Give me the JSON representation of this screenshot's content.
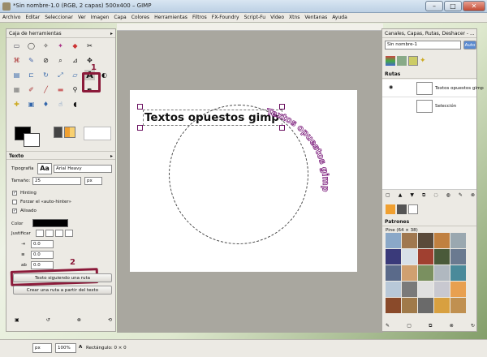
{
  "window": {
    "title": "*Sin nombre-1.0 (RGB, 2 capas) 500x400 – GIMP",
    "minimize": "–",
    "maximize": "□",
    "close": "✕"
  },
  "menu": [
    "Archivo",
    "Editar",
    "Seleccionar",
    "Ver",
    "Imagen",
    "Capa",
    "Colores",
    "Herramientas",
    "Filtros",
    "FX-Foundry",
    "Script-Fu",
    "Vídeo",
    "Xtns",
    "Ventanas",
    "Ayuda"
  ],
  "canvas": {
    "main_text": "Textos opuestos gimp",
    "path_text": "Textos opuestos gimp"
  },
  "toolbox": {
    "title": "Caja de herramientas",
    "tool_options_title": "Texto",
    "typography_label": "Tipografía",
    "font_preview": "Aa",
    "font_value": "Arial Heavy",
    "size_label": "Tamaño:",
    "size_value": "25",
    "size_unit": "px",
    "hinting_label": "Hinting",
    "autohinter_label": "Forzar el «auto-hinter»",
    "antialias_label": "Alisado",
    "color_label": "Color",
    "color_value": "#000000",
    "justify_label": "Justificar",
    "indent_value": "0.0",
    "line_spacing_value": "0.0",
    "letter_spacing_value": "0.0",
    "text_along_path_button": "Texto siguiendo una ruta",
    "path_from_text_button": "Crear una ruta a partir del texto",
    "annotation_1": "1",
    "annotation_2": "2"
  },
  "dock": {
    "tabs_title": "Canales, Capas, Rutas, Deshacer - ...",
    "image_select": "Sin nombre-1",
    "auto_button": "Auto",
    "paths_title": "Rutas",
    "paths": [
      "Textos opuestos gimp",
      "Selección"
    ],
    "patterns_title": "Patrones",
    "patterns_subtitle": "Pine (64 × 38)"
  },
  "status": {
    "unit": "px",
    "zoom": "100%",
    "message": "Rectángulo: 0 × 0"
  }
}
